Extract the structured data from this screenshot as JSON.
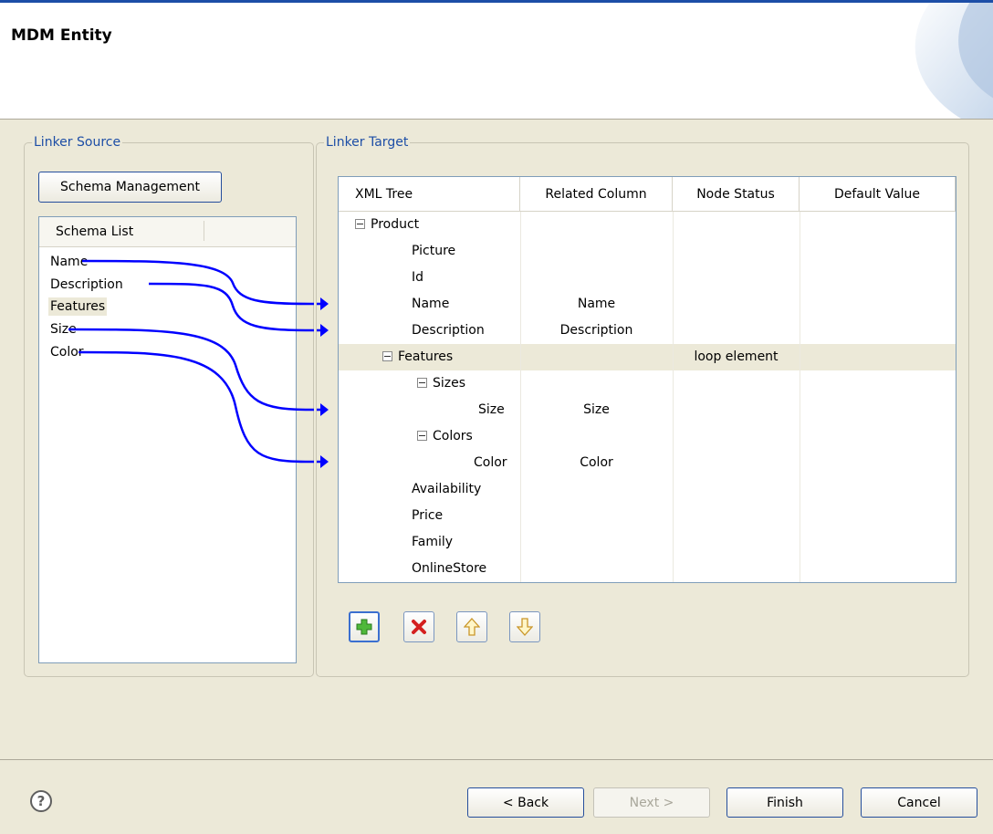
{
  "header": {
    "title": "MDM Entity"
  },
  "linker_source": {
    "legend": "Linker Source",
    "schema_management_label": "Schema Management",
    "schema_list_header": "Schema List",
    "items": [
      "Name",
      "Description",
      "Features",
      "Size",
      "Color"
    ],
    "selected_item": "Features"
  },
  "linker_target": {
    "legend": "Linker Target",
    "columns": [
      "XML Tree",
      "Related Column",
      "Node Status",
      "Default Value"
    ],
    "rows": [
      {
        "name": "Product",
        "related": "",
        "status": "",
        "expander": true
      },
      {
        "name": "Picture",
        "related": "",
        "status": ""
      },
      {
        "name": "Id",
        "related": "",
        "status": ""
      },
      {
        "name": "Name",
        "related": "Name",
        "status": ""
      },
      {
        "name": "Description",
        "related": "Description",
        "status": ""
      },
      {
        "name": "Features",
        "related": "",
        "status": "loop element",
        "expander": true,
        "selected": true
      },
      {
        "name": "Sizes",
        "related": "",
        "status": "",
        "expander": true
      },
      {
        "name": "Size",
        "related": "Size",
        "status": ""
      },
      {
        "name": "Colors",
        "related": "",
        "status": "",
        "expander": true
      },
      {
        "name": "Color",
        "related": "Color",
        "status": ""
      },
      {
        "name": "Availability",
        "related": "",
        "status": ""
      },
      {
        "name": "Price",
        "related": "",
        "status": ""
      },
      {
        "name": "Family",
        "related": "",
        "status": ""
      },
      {
        "name": "OnlineStore",
        "related": "",
        "status": ""
      }
    ],
    "toolbar": [
      "add-icon",
      "delete-icon",
      "move-up-icon",
      "move-down-icon"
    ]
  },
  "links": [
    {
      "from": "Name",
      "to": "Name"
    },
    {
      "from": "Description",
      "to": "Description"
    },
    {
      "from": "Size",
      "to": "Size"
    },
    {
      "from": "Color",
      "to": "Color"
    }
  ],
  "footer": {
    "help_icon": "?",
    "back_label": "< Back",
    "next_label": "Next >",
    "finish_label": "Finish",
    "cancel_label": "Cancel"
  },
  "colors": {
    "accent": "#1c4ea7",
    "link_line": "#0000ff",
    "legend_text": "#1d4ea6"
  }
}
